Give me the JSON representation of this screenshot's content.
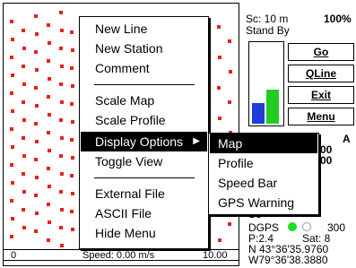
{
  "map": {
    "speed_min": "0",
    "speed_label": "Speed: 0.00 m/s",
    "speed_max": "10.00"
  },
  "status": {
    "sc_label": "Sc:  10 m",
    "battery": "100%",
    "mode": "Stand By",
    "partial_a": "A",
    "partial_00a": "00",
    "partial_00b": "00",
    "partial_sc": "Sc",
    "dgps": "DGPS",
    "dgps_value": "300",
    "p_value": "P:2.4",
    "sat_value": "Sat: 8",
    "lat": "N 43°36'35.9760",
    "lon": "W79°36'38.3880"
  },
  "buttons": {
    "go": "Go",
    "qline": "QLine",
    "exit": "Exit",
    "menu": "Menu"
  },
  "signal_bars": [
    {
      "color": "#1f3fd8",
      "level": 0.25
    },
    {
      "color": "#22cc22",
      "level": 0.42
    }
  ],
  "menu": {
    "items": [
      {
        "label": "New Line"
      },
      {
        "label": "New Station"
      },
      {
        "label": "Comment"
      },
      {
        "label": "Scale Map"
      },
      {
        "label": "Scale Profile"
      },
      {
        "label": "Display Options"
      },
      {
        "label": "Toggle View"
      },
      {
        "label": "External File"
      },
      {
        "label": "ASCII File"
      },
      {
        "label": "Hide Menu"
      }
    ]
  },
  "submenu": {
    "items": [
      {
        "label": "Map"
      },
      {
        "label": "Profile"
      },
      {
        "label": "Speed Bar"
      },
      {
        "label": "GPS Warning"
      }
    ]
  },
  "colors": {
    "track_dot": "#e8201c",
    "gps_fix": "#22dd22",
    "gps_idle": "#ffffff"
  }
}
